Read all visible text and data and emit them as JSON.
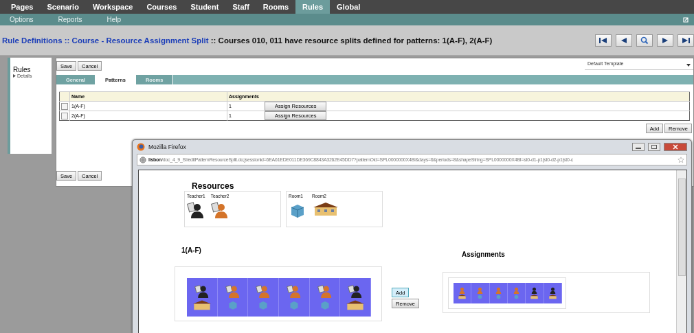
{
  "nav_tabs": [
    {
      "label": "Pages",
      "selected": false
    },
    {
      "label": "Scenario",
      "selected": false
    },
    {
      "label": "Workspace",
      "selected": false
    },
    {
      "label": "Courses",
      "selected": false
    },
    {
      "label": "Student",
      "selected": false
    },
    {
      "label": "Staff",
      "selected": false
    },
    {
      "label": "Rooms",
      "selected": false
    },
    {
      "label": "Rules",
      "selected": true
    },
    {
      "label": "Global",
      "selected": false
    }
  ],
  "menu": [
    "Options",
    "Reports",
    "Help"
  ],
  "header": {
    "link": "Rule Definitions :: Course - Resource Assignment Split",
    "text": ":: Courses 010, 011 have resource splits defined for patterns: 1(A-F), 2(A-F)"
  },
  "sidebar": {
    "title": "Rules",
    "items": [
      "Details"
    ]
  },
  "top_buttons": [
    "Save",
    "Cancel"
  ],
  "template": {
    "value": "Default Template"
  },
  "tabs": [
    {
      "label": "General",
      "selected": false
    },
    {
      "label": "Patterns",
      "selected": true
    },
    {
      "label": "Rooms",
      "selected": false
    }
  ],
  "table": {
    "columns": [
      "Name",
      "Assignments"
    ],
    "rows": [
      {
        "checked": false,
        "name": "1(A-F)",
        "assignments": "1",
        "button": "Assign Resources"
      },
      {
        "checked": false,
        "name": "2(A-F)",
        "assignments": "1",
        "button": "Assign Resources"
      }
    ]
  },
  "table_buttons": [
    "Add",
    "Remove"
  ],
  "bottom_buttons": [
    "Save",
    "Cancel"
  ],
  "popup": {
    "title": "Mozilla Firefox",
    "url_host": "lisbon",
    "url_path": "/doc_4_9_SI/editPatternResourceSplit.do;jsessionid=6EA61EDE011DE369C8843A3262E45DD7?patternOid=SPL0000000X4BI&days=6&periods=8&shapeString=SPL0000000X4BI=st0-d1-p1|st0-d2-p1|st0-c",
    "resources_title": "Resources",
    "resource_groups": [
      [
        {
          "label": "Teacher1",
          "kind": "teacher-dark"
        },
        {
          "label": "Teacher2",
          "kind": "teacher-orange"
        }
      ],
      [
        {
          "label": "Room1",
          "kind": "room-cube"
        },
        {
          "label": "Room2",
          "kind": "building"
        }
      ]
    ],
    "pattern_title": "1(A-F)",
    "pattern_cells": [
      [
        {
          "kind": "teacher-dark"
        },
        {
          "kind": "building"
        }
      ],
      [
        {
          "kind": "teacher-orange"
        },
        {
          "kind": "room-cube"
        }
      ],
      [
        {
          "kind": "teacher-orange"
        },
        {
          "kind": "room-cube"
        }
      ],
      [
        {
          "kind": "teacher-orange"
        },
        {
          "kind": "room-cube"
        }
      ],
      [
        {
          "kind": "teacher-orange"
        },
        {
          "kind": "room-cube"
        }
      ],
      [
        {
          "kind": "teacher-dark"
        },
        {
          "kind": "building"
        }
      ]
    ],
    "buttons": [
      "Add",
      "Remove"
    ],
    "assignments_title": "Assignments",
    "assignment_cells": [
      [
        {
          "kind": "teacher-orange"
        },
        {
          "kind": "building"
        }
      ],
      [
        {
          "kind": "teacher-orange"
        },
        {
          "kind": "room-cube"
        }
      ],
      [
        {
          "kind": "teacher-orange"
        },
        {
          "kind": "room-cube"
        }
      ],
      [
        {
          "kind": "teacher-orange"
        },
        {
          "kind": "room-cube"
        }
      ],
      [
        {
          "kind": "teacher-dark"
        },
        {
          "kind": "building"
        }
      ],
      [
        {
          "kind": "teacher-dark"
        },
        {
          "kind": "building"
        }
      ]
    ]
  }
}
